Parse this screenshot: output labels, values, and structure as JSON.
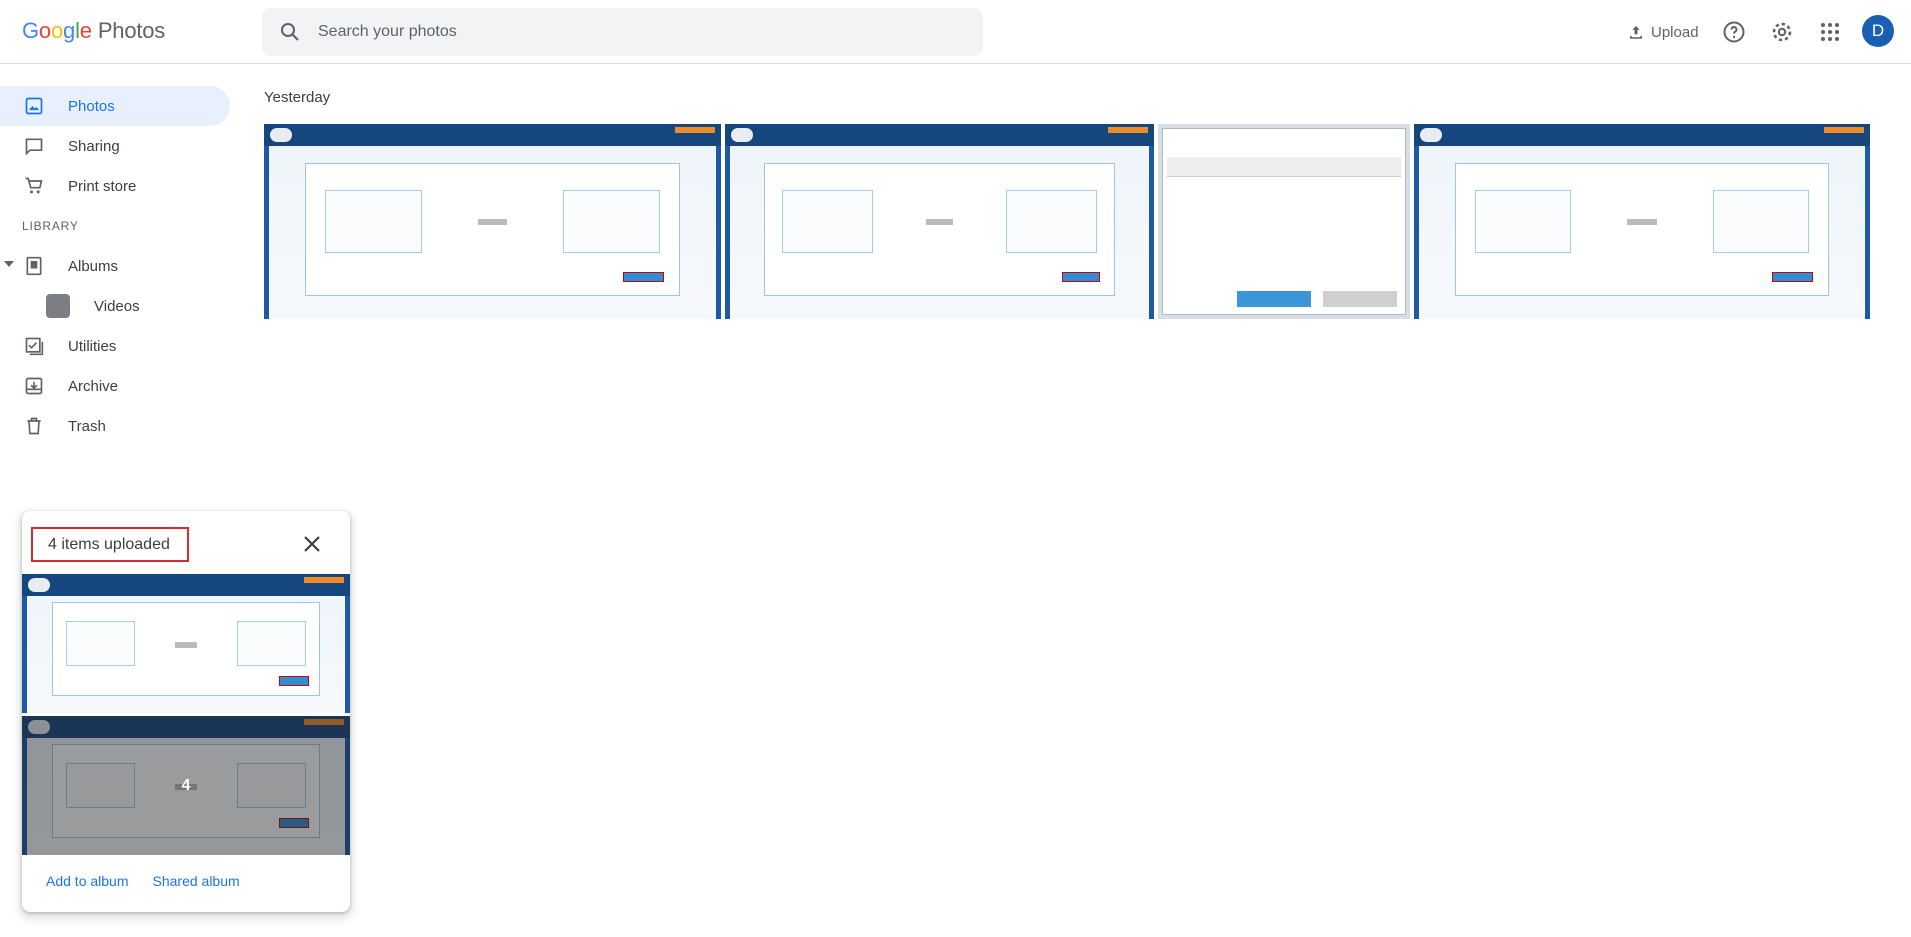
{
  "header": {
    "logo": {
      "letters": [
        "G",
        "o",
        "o",
        "g",
        "l",
        "e"
      ],
      "colors": [
        "#4285f4",
        "#ea4335",
        "#fbbc05",
        "#4285f4",
        "#34a853",
        "#ea4335"
      ],
      "product": "Photos"
    },
    "search": {
      "placeholder": "Search your photos",
      "value": ""
    },
    "upload_label": "Upload",
    "icons": [
      "search-icon",
      "upload-icon",
      "help-icon",
      "settings-icon",
      "apps-icon"
    ],
    "avatar_initial": "D",
    "avatar_color": "#1a5fb4"
  },
  "sidebar": {
    "items": [
      {
        "label": "Photos",
        "icon": "photo-icon",
        "active": true
      },
      {
        "label": "Sharing",
        "icon": "chat-icon"
      },
      {
        "label": "Print store",
        "icon": "cart-icon"
      }
    ],
    "section_label": "LIBRARY",
    "library": [
      {
        "label": "Albums",
        "icon": "album-icon"
      },
      {
        "label": "Videos",
        "icon": "video-thumbnail"
      },
      {
        "label": "Utilities",
        "icon": "checklist-icon"
      },
      {
        "label": "Archive",
        "icon": "archive-icon"
      },
      {
        "label": "Trash",
        "icon": "trash-icon"
      }
    ]
  },
  "main": {
    "date_group": "Yesterday",
    "photos_count_shown": 4
  },
  "upload_panel": {
    "title": "4 items uploaded",
    "more_count": "4",
    "actions": {
      "add_to_album": "Add to album",
      "shared_album": "Shared album"
    }
  },
  "colors": {
    "accent": "#1a73e8",
    "active_bg": "#e8f0fe",
    "highlight_border": "#d32f2f"
  }
}
